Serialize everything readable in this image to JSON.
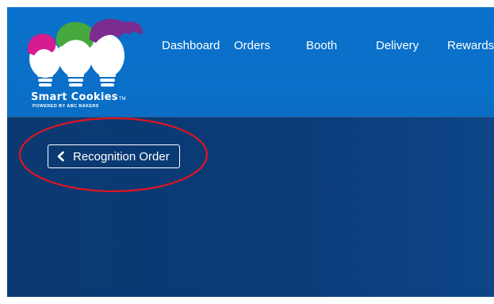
{
  "brand": {
    "name": "Smart Cookies",
    "trademark": "TM",
    "tagline": "POWERED BY ABC BAKERS"
  },
  "nav": {
    "items": [
      {
        "label": "Dashboard"
      },
      {
        "label": "Orders"
      },
      {
        "label": "Booth"
      },
      {
        "label": "Delivery"
      },
      {
        "label": "Rewards"
      }
    ]
  },
  "back_button": {
    "label": "Recognition Order",
    "icon": "chevron-left-icon"
  },
  "colors": {
    "header": "#0a70c8",
    "content_bg": "#0b3a72",
    "annotation": "#e0141f",
    "text": "#ffffff"
  }
}
